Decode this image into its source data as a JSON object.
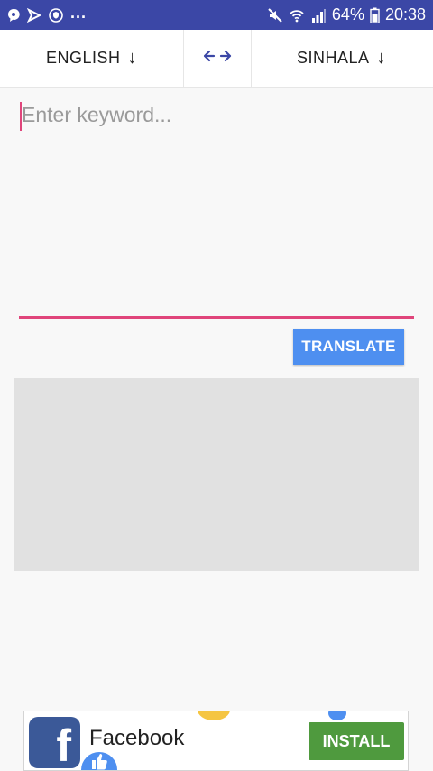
{
  "status_bar": {
    "battery_percent": "64%",
    "time": "20:38",
    "overflow": "...",
    "icons": [
      "chat-icon",
      "arrow-send-icon",
      "shield-icon",
      "mute-icon",
      "wifi-icon",
      "signal-icon",
      "battery-icon"
    ],
    "background": "#3b47a6"
  },
  "language_bar": {
    "source_language": "ENGLISH",
    "target_language": "SINHALA",
    "dropdown_arrow": "↓",
    "swap_icon": "swap-arrows-icon"
  },
  "input": {
    "placeholder": "Enter keyword...",
    "value": "",
    "accent": "#e0457b"
  },
  "actions": {
    "translate_label": "TRANSLATE",
    "translate_color": "#4e8ff0"
  },
  "ad": {
    "app_name": "Facebook",
    "install_label": "INSTALL",
    "install_color": "#4f9a3e",
    "logo_letter": "f",
    "logo_color": "#3b5998"
  }
}
